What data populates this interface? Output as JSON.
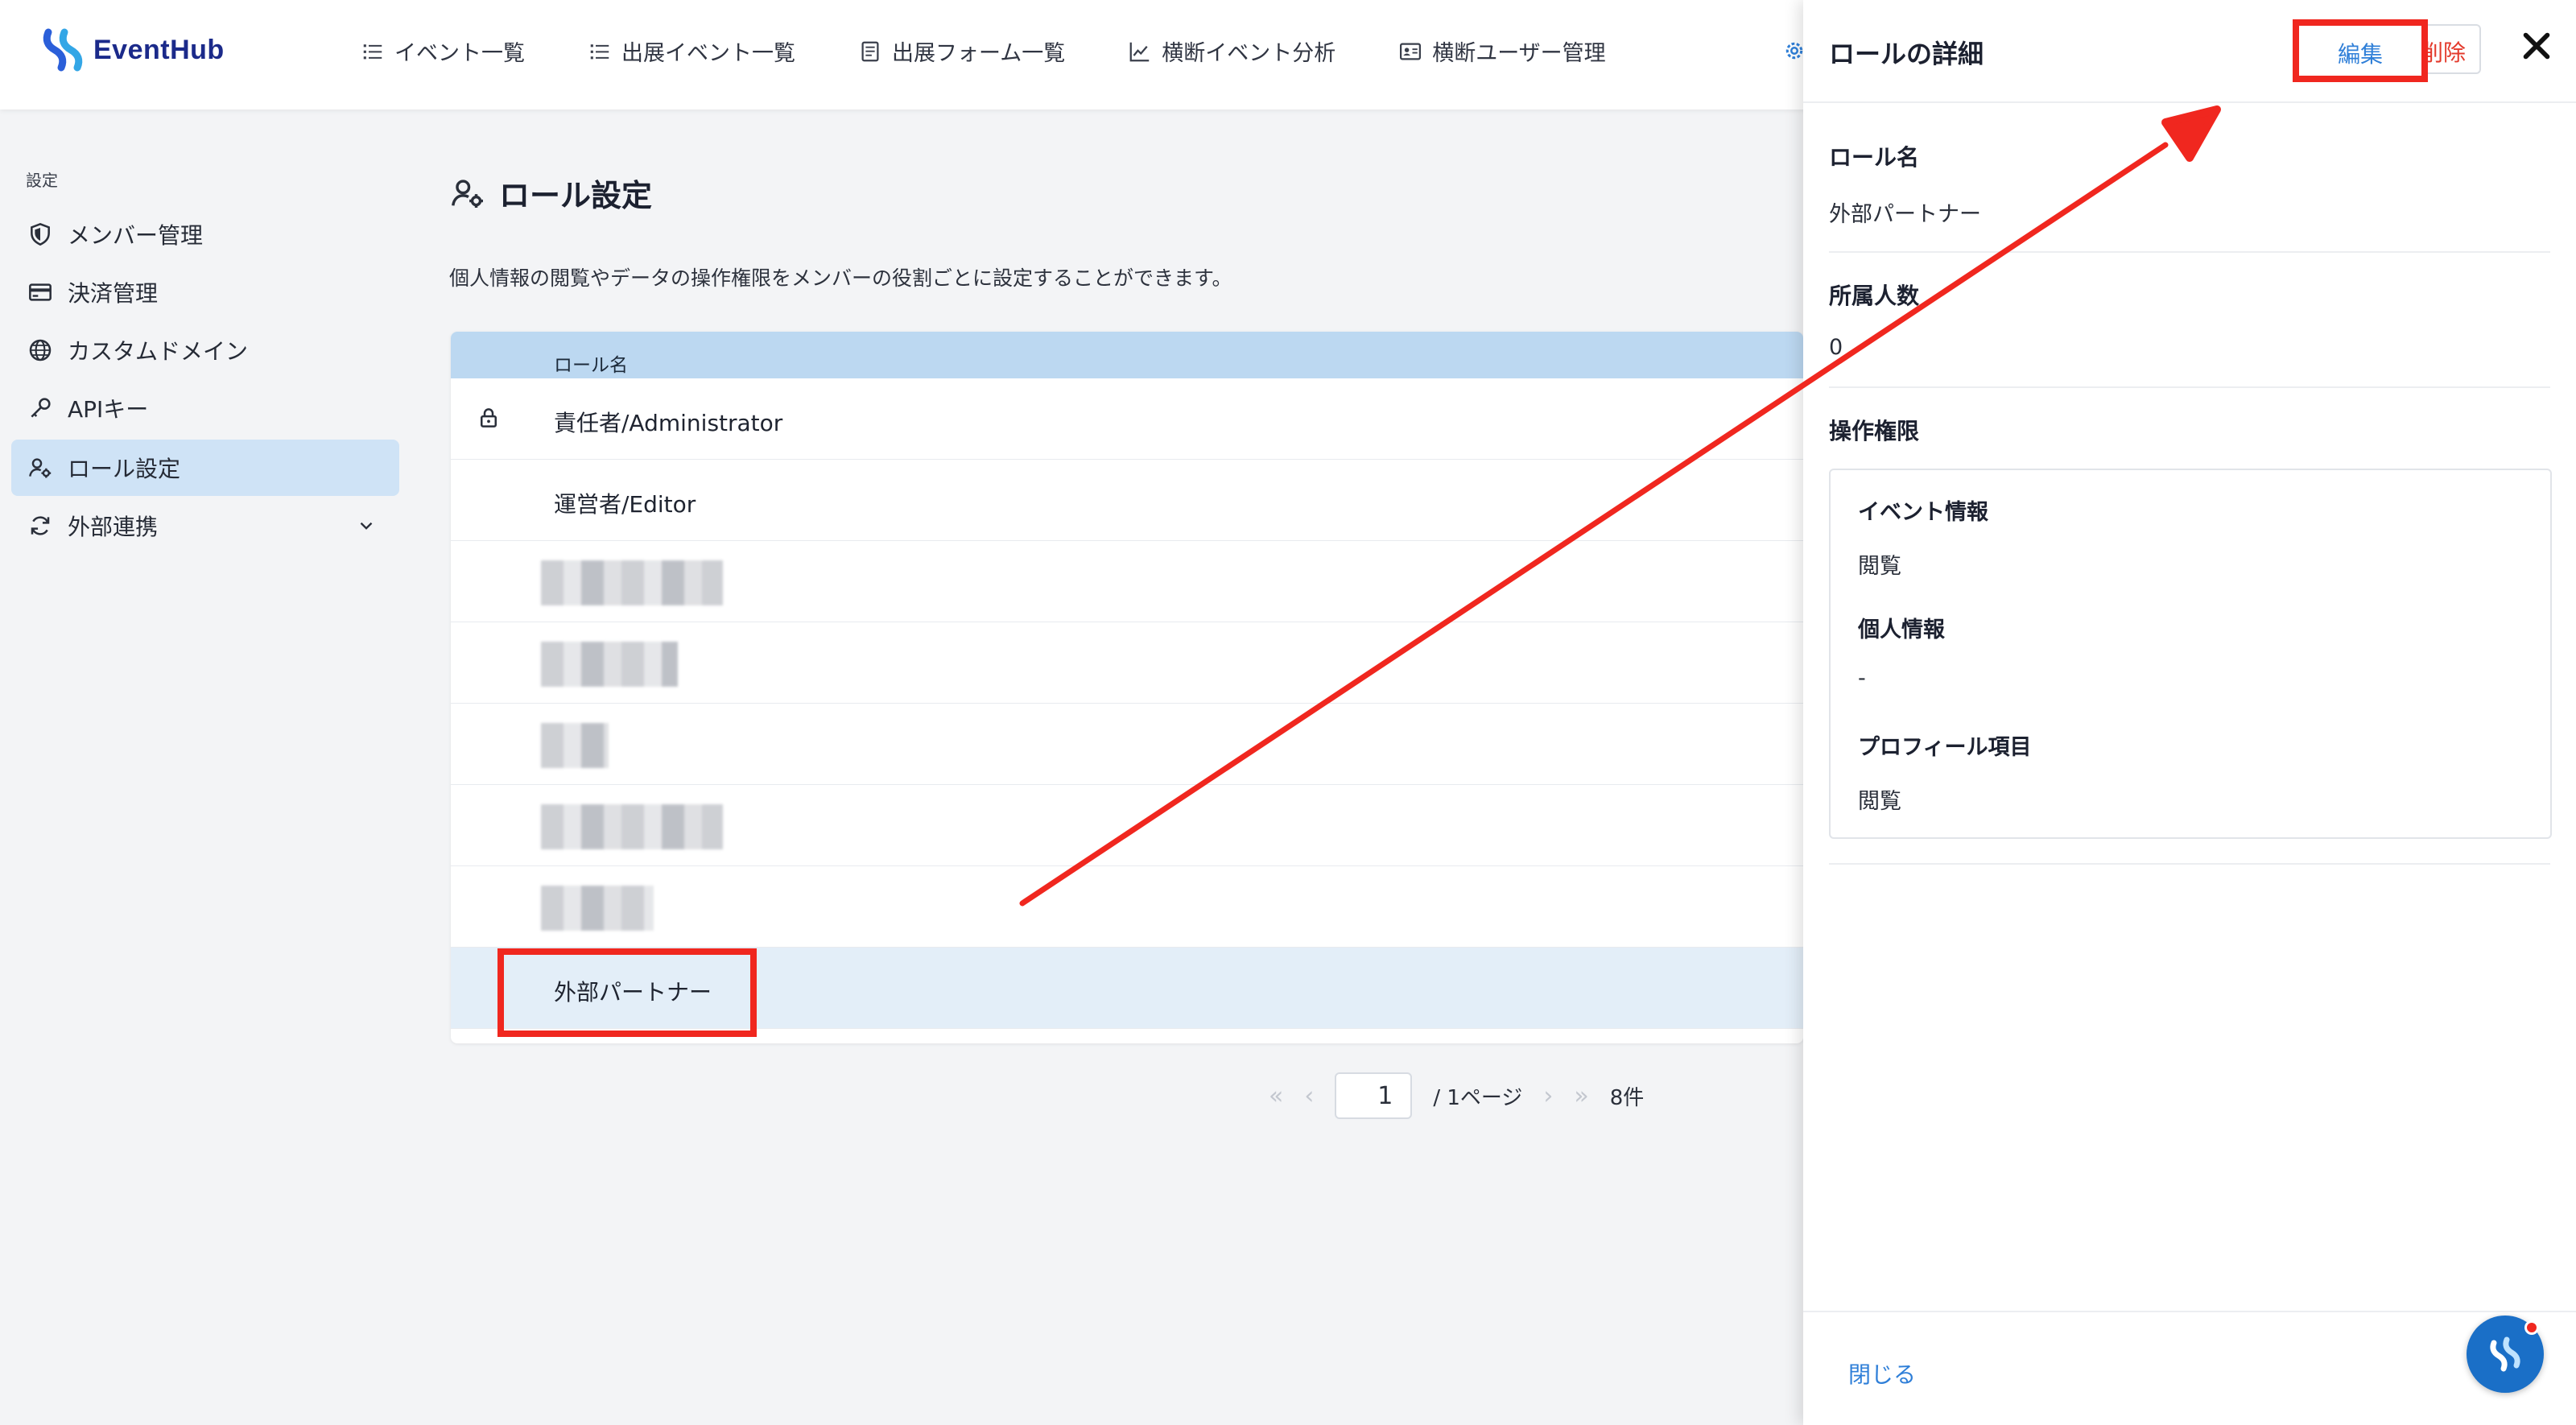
{
  "app": {
    "name": "EventHub"
  },
  "nav": {
    "items": [
      {
        "label": "イベント一覧",
        "icon": "list-icon"
      },
      {
        "label": "出展イベント一覧",
        "icon": "list-icon"
      },
      {
        "label": "出展フォーム一覧",
        "icon": "form-icon"
      },
      {
        "label": "横断イベント分析",
        "icon": "chart-icon"
      },
      {
        "label": "横断ユーザー管理",
        "icon": "id-card-icon"
      }
    ]
  },
  "sidebar": {
    "heading": "設定",
    "items": [
      {
        "label": "メンバー管理",
        "icon": "shield-icon"
      },
      {
        "label": "決済管理",
        "icon": "credit-card-icon"
      },
      {
        "label": "カスタムドメイン",
        "icon": "globe-icon"
      },
      {
        "label": "APIキー",
        "icon": "key-icon"
      },
      {
        "label": "ロール設定",
        "icon": "user-gear-icon",
        "active": true
      },
      {
        "label": "外部連携",
        "icon": "sync-icon"
      }
    ]
  },
  "main": {
    "title": "ロール設定",
    "description": "個人情報の閲覧やデータの操作権限をメンバーの役割ごとに設定することができます。",
    "table": {
      "header": "ロール名",
      "rows": [
        {
          "label": "責任者/Administrator",
          "locked": true
        },
        {
          "label": "運営者/Editor"
        },
        {
          "label": ""
        },
        {
          "label": ""
        },
        {
          "label": ""
        },
        {
          "label": ""
        },
        {
          "label": ""
        },
        {
          "label": "外部パートナー",
          "selected": true
        }
      ]
    },
    "pager": {
      "current": "1",
      "total": "/ 1ページ",
      "count": "8件"
    }
  },
  "drawer": {
    "title": "ロールの詳細",
    "edit_label": "編集",
    "delete_label": "削除",
    "role_name_label": "ロール名",
    "role_name_value": "外部パートナー",
    "members_label": "所属人数",
    "members_value": "0",
    "permissions_label": "操作権限",
    "permissions": [
      {
        "label": "イベント情報",
        "value": "閲覧"
      },
      {
        "label": "個人情報",
        "value": "-"
      },
      {
        "label": "プロフィール項目",
        "value": "閲覧"
      }
    ],
    "close_label": "閉じる"
  },
  "colors": {
    "accent": "#2f7fd8",
    "highlight": "#f0271f",
    "active_nav": "#cfe3f6",
    "table_header": "#bcd8f1"
  }
}
